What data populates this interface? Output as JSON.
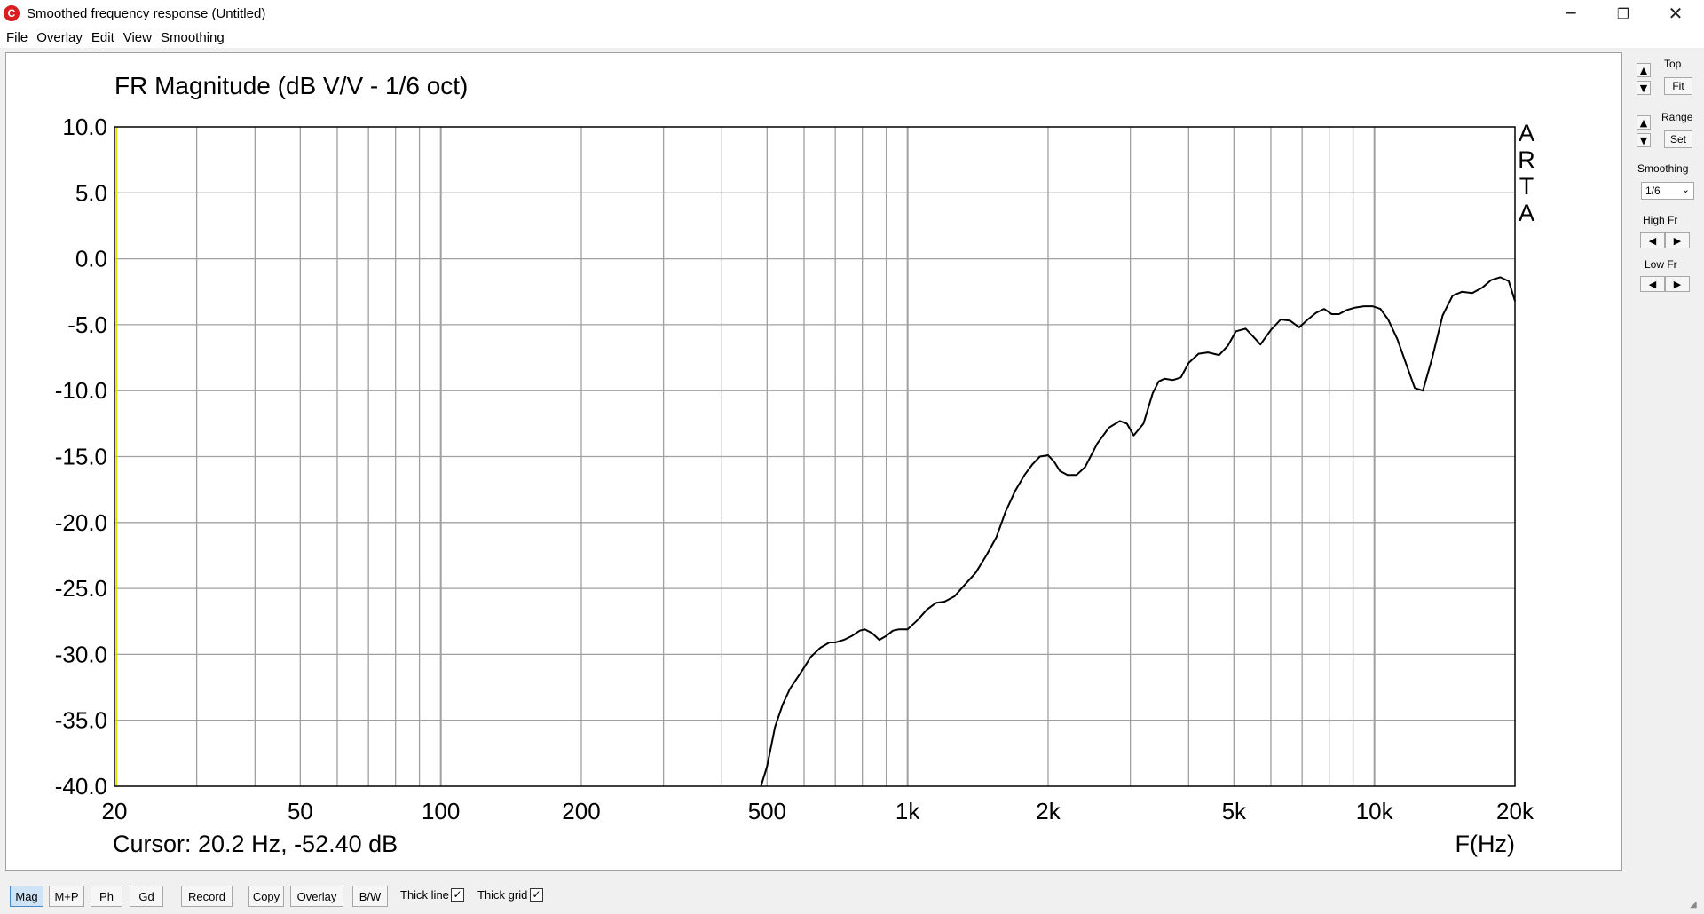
{
  "window": {
    "title": "Smoothed frequency response (Untitled)",
    "icon": "arta-logo-icon",
    "controls": {
      "minimize": "─",
      "maximize": "❐",
      "close": "✕"
    }
  },
  "menu": [
    {
      "label": "File",
      "accel": "F",
      "rest": "ile"
    },
    {
      "label": "Overlay",
      "accel": "O",
      "rest": "verlay"
    },
    {
      "label": "Edit",
      "accel": "E",
      "rest": "dit"
    },
    {
      "label": "View",
      "accel": "V",
      "rest": "iew"
    },
    {
      "label": "Smoothing",
      "accel": "S",
      "rest": "moothing"
    }
  ],
  "plot": {
    "cursor_text": "Cursor: 20.2 Hz, -52.40 dB",
    "brand_letters": [
      "A",
      "R",
      "T",
      "A"
    ],
    "colors": {
      "curve": "#000000",
      "grid": "#a0a0a0",
      "cursor_line": "#e0e000"
    }
  },
  "chart_data": {
    "type": "line",
    "title": "FR Magnitude (dB V/V - 1/6 oct)",
    "xlabel": "F(Hz)",
    "ylabel": "",
    "xscale": "log",
    "xlim": [
      20,
      20000
    ],
    "ylim": [
      -40,
      10
    ],
    "xticks": [
      20,
      50,
      100,
      200,
      500,
      1000,
      2000,
      5000,
      10000,
      20000
    ],
    "xtick_labels": [
      "20",
      "50",
      "100",
      "200",
      "500",
      "1k",
      "2k",
      "5k",
      "10k",
      "20k"
    ],
    "yticks": [
      10,
      5,
      0,
      -5,
      -10,
      -15,
      -20,
      -25,
      -30,
      -35,
      -40
    ],
    "ytick_labels": [
      "10.0",
      "5.0",
      "0.0",
      "-5.0",
      "-10.0",
      "-15.0",
      "-20.0",
      "-25.0",
      "-30.0",
      "-35.0",
      "-40.0"
    ],
    "grid": true,
    "cursor": {
      "x": 20.2,
      "y": -52.4
    },
    "series": [
      {
        "x": [
          485,
          500,
          520,
          540,
          560,
          580,
          600,
          620,
          650,
          680,
          700,
          730,
          760,
          790,
          810,
          840,
          870,
          900,
          930,
          960,
          1000,
          1050,
          1100,
          1150,
          1200,
          1260,
          1320,
          1400,
          1480,
          1550,
          1620,
          1700,
          1780,
          1850,
          1920,
          2000,
          2060,
          2120,
          2200,
          2300,
          2400,
          2550,
          2700,
          2850,
          2950,
          3050,
          3200,
          3350,
          3450,
          3550,
          3700,
          3850,
          4000,
          4200,
          4400,
          4650,
          4850,
          5050,
          5300,
          5500,
          5700,
          6000,
          6300,
          6600,
          6900,
          7200,
          7500,
          7800,
          8100,
          8400,
          8700,
          9100,
          9500,
          9900,
          10300,
          10700,
          11200,
          11700,
          12200,
          12700,
          13300,
          14000,
          14700,
          15400,
          16200,
          17000,
          17800,
          18600,
          19400,
          20000
        ],
        "y": [
          -40.0,
          -38.5,
          -35.5,
          -33.8,
          -32.6,
          -31.8,
          -31.0,
          -30.2,
          -29.5,
          -29.1,
          -29.1,
          -28.9,
          -28.6,
          -28.2,
          -28.1,
          -28.4,
          -28.9,
          -28.6,
          -28.2,
          -28.1,
          -28.1,
          -27.4,
          -26.6,
          -26.1,
          -26.0,
          -25.6,
          -24.8,
          -23.8,
          -22.4,
          -21.1,
          -19.2,
          -17.6,
          -16.4,
          -15.6,
          -15.0,
          -14.9,
          -15.4,
          -16.1,
          -16.4,
          -16.4,
          -15.8,
          -14.0,
          -12.8,
          -12.3,
          -12.5,
          -13.4,
          -12.5,
          -10.2,
          -9.3,
          -9.1,
          -9.2,
          -9.0,
          -7.9,
          -7.2,
          -7.1,
          -7.3,
          -6.6,
          -5.5,
          -5.3,
          -5.9,
          -6.5,
          -5.4,
          -4.6,
          -4.7,
          -5.2,
          -4.6,
          -4.1,
          -3.8,
          -4.2,
          -4.2,
          -3.9,
          -3.7,
          -3.6,
          -3.6,
          -3.8,
          -4.6,
          -6.1,
          -8.0,
          -9.8,
          -10.0,
          -7.5,
          -4.3,
          -2.8,
          -2.5,
          -2.6,
          -2.2,
          -1.6,
          -1.4,
          -1.7,
          -3.2
        ]
      }
    ]
  },
  "right_panel": {
    "top_label": "Top",
    "fit_label": "Fit",
    "range_label": "Range",
    "set_label": "Set",
    "smoothing_label": "Smoothing",
    "smoothing_value": "1/6",
    "high_fr_label": "High Fr",
    "low_fr_label": "Low Fr",
    "up_arrow": "▲",
    "down_arrow": "▼",
    "left_arrow": "◀",
    "right_arrow": "▶"
  },
  "toolbar": {
    "buttons": [
      {
        "id": "mag",
        "label": "Mag",
        "accel": "M",
        "rest": "ag",
        "active": true
      },
      {
        "id": "mp",
        "label": "M+P",
        "accel": "M",
        "rest": "+P",
        "active": false
      },
      {
        "id": "ph",
        "label": "Ph",
        "accel": "P",
        "rest": "h",
        "active": false
      },
      {
        "id": "gd",
        "label": "Gd",
        "accel": "G",
        "rest": "d",
        "active": false
      },
      {
        "id": "record",
        "label": "Record",
        "accel": "R",
        "rest": "ecord",
        "active": false
      },
      {
        "id": "copy",
        "label": "Copy",
        "accel": "C",
        "rest": "opy",
        "active": false
      },
      {
        "id": "overlay",
        "label": "Overlay",
        "accel": "O",
        "rest": "verlay",
        "active": false
      },
      {
        "id": "bw",
        "label": "B/W",
        "accel": "B",
        "rest": "/W",
        "active": false
      }
    ],
    "thick_line_label": "Thick line",
    "thick_line_checked": true,
    "thick_grid_label": "Thick grid",
    "thick_grid_checked": true,
    "check_glyph": "✓"
  }
}
